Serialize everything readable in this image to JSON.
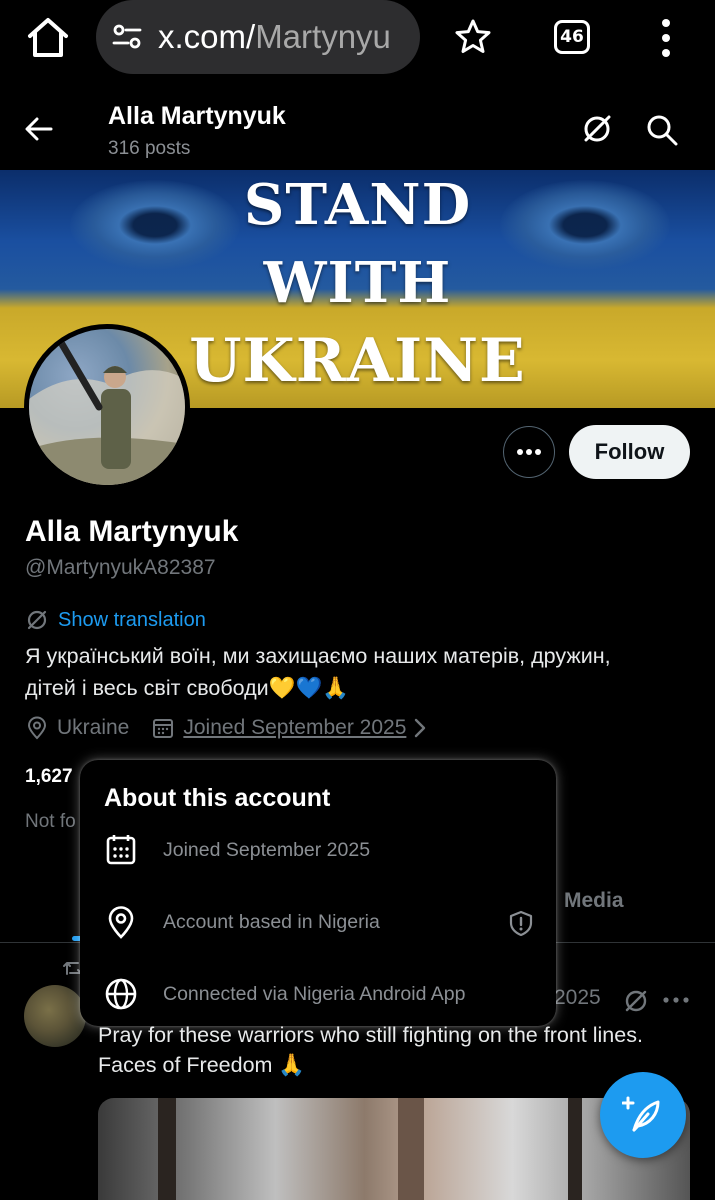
{
  "browser": {
    "url_host": "x.com/",
    "url_path": "Martynyu",
    "tab_count": "46",
    "icons": [
      "home-icon",
      "site-settings-icon",
      "star-icon",
      "tabs-icon",
      "menu-icon"
    ]
  },
  "header": {
    "name": "Alla Martynyuk",
    "posts": "316 posts"
  },
  "banner": {
    "line1": "STAND",
    "line2": "WITH",
    "line3": "UKRAINE"
  },
  "actions": {
    "follow": "Follow"
  },
  "profile": {
    "name": "Alla Martynyuk",
    "handle": "@MartynyukA82387",
    "show_translation": "Show translation",
    "bio_line1": "Я український воїн, ми захищаємо наших матерів, дружин,",
    "bio_line2": "дітей і весь світ свободи💛💙🙏",
    "location": "Ukraine",
    "joined": "Joined September 2025",
    "following_count_partial": "1,627",
    "not_followed_partial": "Not fo"
  },
  "tabs": {
    "media": "Media"
  },
  "popover": {
    "title": "About this account",
    "joined": "Joined September 2025",
    "based_in": "Account based in Nigeria",
    "connected_via": "Connected via Nigeria Android App"
  },
  "post": {
    "date_partial": "2025",
    "text_line1": "Pray for these warriors who still fighting on the front lines.",
    "text_line2": "Faces of Freedom 🙏"
  },
  "colors": {
    "accent": "#1d9bf0",
    "background": "#000000",
    "muted": "#71767b"
  }
}
